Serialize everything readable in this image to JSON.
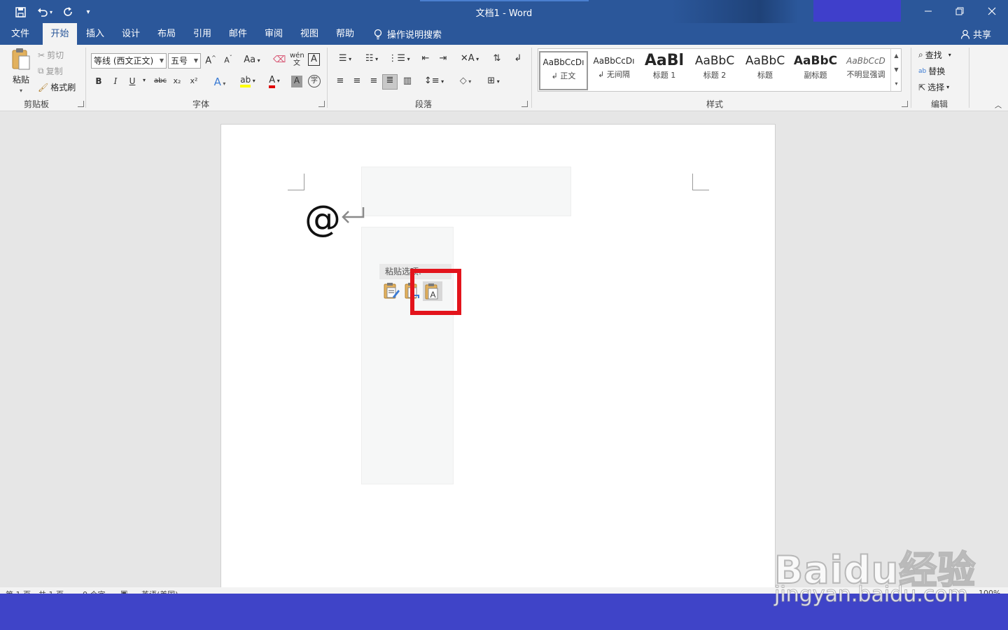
{
  "window": {
    "title": "文档1  -  Word",
    "quick_access": [
      "save-icon",
      "undo-icon",
      "redo-icon",
      "customize-icon"
    ],
    "controls": [
      "minimize-icon",
      "restore-icon",
      "close-icon"
    ]
  },
  "menu": {
    "tabs": [
      "文件",
      "开始",
      "插入",
      "设计",
      "布局",
      "引用",
      "邮件",
      "审阅",
      "视图",
      "帮助"
    ],
    "active_tab": "开始",
    "tell_me": "操作说明搜索",
    "share": "共享"
  },
  "ribbon": {
    "clipboard": {
      "label": "剪贴板",
      "paste": "粘贴",
      "cut": "剪切",
      "copy": "复制",
      "format_painter": "格式刷"
    },
    "font": {
      "label": "字体",
      "font_name": "等线 (西文正文)",
      "font_size": "五号",
      "bold": "B",
      "italic": "I",
      "underline": "U",
      "strike": "abc",
      "subscript": "x₂",
      "superscript": "x²",
      "change_case": "Aa",
      "phonetic": "wén",
      "border_char": "A"
    },
    "paragraph": {
      "label": "段落"
    },
    "styles": {
      "label": "样式",
      "items": [
        {
          "preview": "AaBbCcDı",
          "name": "↲ 正文"
        },
        {
          "preview": "AaBbCcDı",
          "name": "↲ 无间隔"
        },
        {
          "preview": "AaBl",
          "name": "标题 1"
        },
        {
          "preview": "AaBbC",
          "name": "标题 2"
        },
        {
          "preview": "AaBbC",
          "name": "标题"
        },
        {
          "preview": "AaBbC",
          "name": "副标题"
        },
        {
          "preview": "AaBbCcD",
          "name": "不明显强调"
        }
      ]
    },
    "editing": {
      "label": "编辑",
      "find": "查找",
      "replace": "替换",
      "select": "选择"
    }
  },
  "document": {
    "content": "@",
    "paste_options_title": "粘贴选项:",
    "paste_options": [
      "keep-source-formatting-icon",
      "merge-formatting-icon",
      "keep-text-only-icon"
    ],
    "highlight_color": "#e3141c"
  },
  "status": {
    "page": "第 1 页，共 1 页",
    "words": "0 个字",
    "language": "英语(美国)",
    "zoom": "100%"
  },
  "watermark": {
    "brand": "Baidu经验",
    "url": "jingyan.baidu.com"
  },
  "colors": {
    "word_blue": "#2b579a",
    "ribbon_bg": "#f3f3f3",
    "band": "#3f44c8"
  }
}
